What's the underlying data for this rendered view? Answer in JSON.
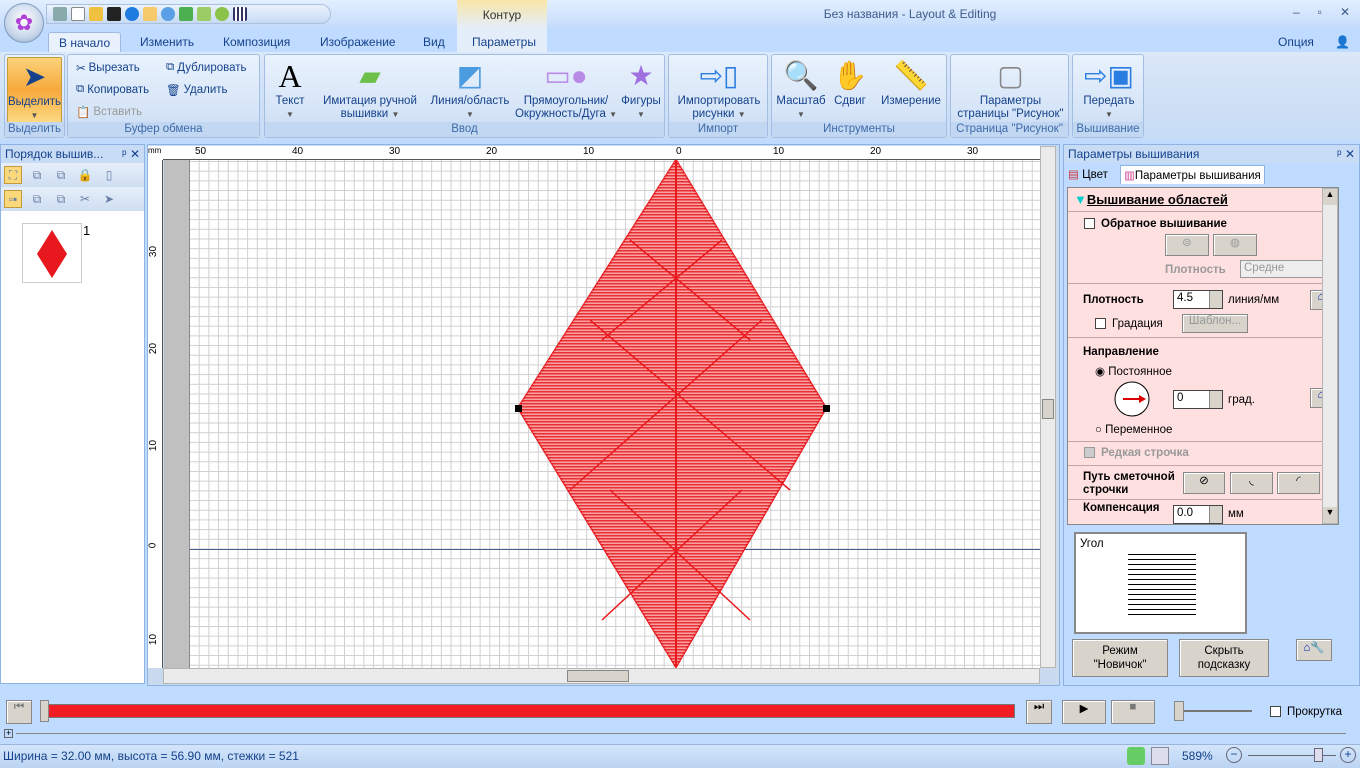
{
  "window": {
    "title": "Без названия - Layout & Editing",
    "context_tab": "Контур"
  },
  "ribbon_tabs": [
    "В начало",
    "Изменить",
    "Композиция",
    "Изображение",
    "Вид",
    "Параметры"
  ],
  "option": "Опция",
  "groups": {
    "select": {
      "label": "Выделить",
      "button": "Выделить"
    },
    "clipboard": {
      "label": "Буфер обмена",
      "cut": "Вырезать",
      "copy": "Копировать",
      "paste": "Вставить",
      "duplicate": "Дублировать",
      "delete": "Удалить"
    },
    "input": {
      "label": "Ввод",
      "text": "Текст",
      "hand1": "Имитация ручной",
      "hand2": "вышивки",
      "line": "Линия/область",
      "rect1": "Прямоугольник/",
      "rect2": "Окружность/Дуга",
      "shapes": "Фигуры"
    },
    "import": {
      "label": "Импорт",
      "btn1": "Импортировать",
      "btn2": "рисунки"
    },
    "tools": {
      "label": "Инструменты",
      "zoom": "Масштаб",
      "pan": "Сдвиг",
      "measure": "Измерение"
    },
    "page": {
      "label": "Страница \"Рисунок\"",
      "btn1": "Параметры",
      "btn2": "страницы \"Рисунок\""
    },
    "embroidery": {
      "label": "Вышивание",
      "send": "Передать"
    }
  },
  "left_panel": {
    "title": "Порядок вышив...",
    "item_number": "1"
  },
  "ruler": {
    "unit": "mm",
    "top": [
      "50",
      "40",
      "30",
      "20",
      "10",
      "0",
      "10",
      "20",
      "30"
    ],
    "left": [
      "30",
      "20",
      "10",
      "0",
      "10"
    ]
  },
  "design": {
    "color": "#e8191e",
    "width_mm": 32.0,
    "height_mm": 56.9
  },
  "right_panel": {
    "title": "Параметры вышивания",
    "tabs": [
      "Цвет",
      "Параметры вышивания"
    ],
    "section_title": "Вышивание областей",
    "reverse": "Обратное вышивание",
    "density_label_disabled": "Плотность",
    "density_select": "Средне",
    "density": "Плотность",
    "density_value": "4.5",
    "density_unit": "линия/мм",
    "gradation": "Градация",
    "template": "Шаблон...",
    "direction": "Направление",
    "constant": "Постоянное",
    "angle_value": "0",
    "angle_unit": "град.",
    "variable": "Переменное",
    "sparse": "Редкая строчка",
    "underlay1": "Путь сметочной",
    "underlay2": "строчки",
    "compensation": "Компенсация",
    "comp_value": "0.0",
    "comp_unit": "мм",
    "preview_label": "Угол",
    "novice1": "Режим",
    "novice2": "\"Новичок\"",
    "hide1": "Скрыть",
    "hide2": "подсказку"
  },
  "playback": {
    "scroll_label": "Прокрутка",
    "progress": 0
  },
  "status": {
    "text": "Ширина = 32.00 мм, высота = 56.90 мм, стежки = 521",
    "zoom": "589%"
  }
}
